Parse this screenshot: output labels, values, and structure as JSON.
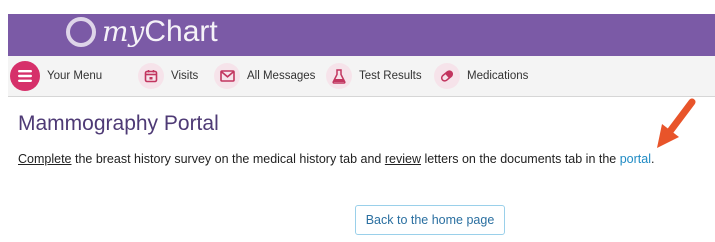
{
  "brand": {
    "name_prefix": "my",
    "name_suffix": "Chart"
  },
  "nav": {
    "items": [
      {
        "label": "Your Menu",
        "icon": "menu-icon"
      },
      {
        "label": "Visits",
        "icon": "calendar-icon"
      },
      {
        "label": "All Messages",
        "icon": "envelope-icon"
      },
      {
        "label": "Test Results",
        "icon": "flask-icon"
      },
      {
        "label": "Medications",
        "icon": "pill-icon"
      }
    ]
  },
  "main": {
    "title": "Mammography Portal",
    "instruction": {
      "word_complete": "Complete",
      "part1": " the breast history survey on the medical history tab and ",
      "word_review": "review",
      "part2": " letters on the documents tab in the ",
      "link_text": "portal",
      "end": "."
    },
    "home_button_label": "Back to the home page"
  },
  "colors": {
    "brand_purple": "#7b5aa6",
    "menu_pink": "#d6306a",
    "link_blue": "#1f8bc4",
    "annotation_arrow": "#e8542a"
  }
}
